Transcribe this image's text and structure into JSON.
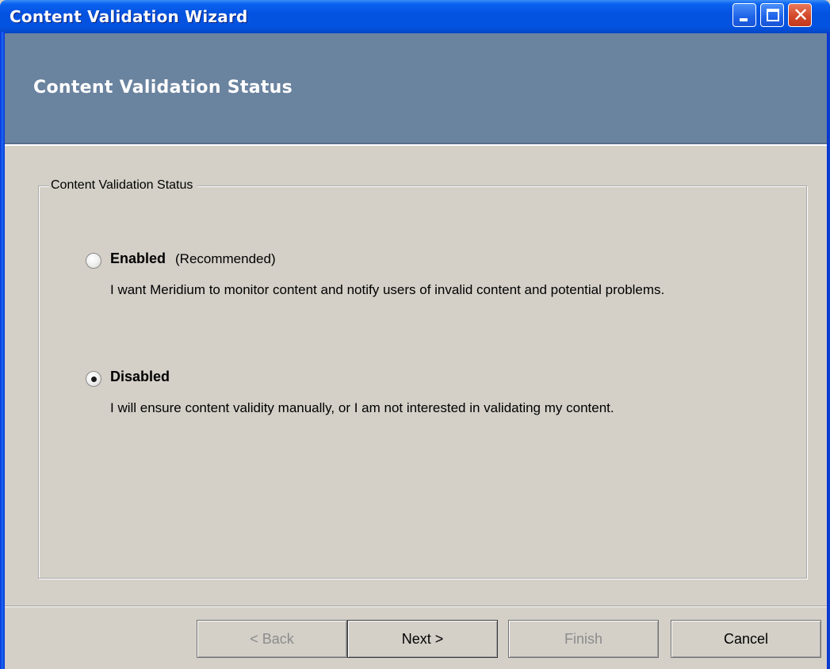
{
  "window": {
    "title": "Content Validation Wizard",
    "controls": [
      "minimize-icon",
      "maximize-icon",
      "close-icon"
    ],
    "accent_color": "#0453e0",
    "header_color": "#6a839f"
  },
  "header": {
    "title": "Content Validation Status"
  },
  "group": {
    "legend": "Content Validation Status",
    "options": [
      {
        "label": "Enabled",
        "note": "(Recommended)",
        "description": "I want Meridium to monitor content and notify users of invalid content and potential problems.",
        "selected": false
      },
      {
        "label": "Disabled",
        "note": "",
        "description": "I will ensure content validity manually, or I am not interested in validating my content.",
        "selected": true
      }
    ]
  },
  "buttons": {
    "back": "< Back",
    "next": "Next >",
    "finish": "Finish",
    "cancel": "Cancel"
  }
}
